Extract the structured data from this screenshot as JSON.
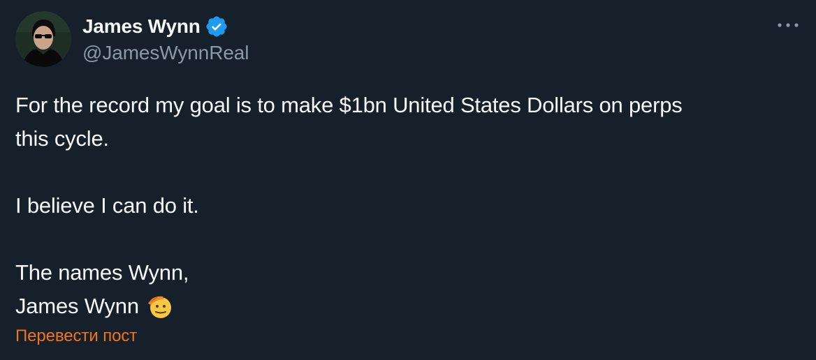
{
  "author": {
    "display_name": "James Wynn",
    "handle": "@JamesWynnReal",
    "verified": true
  },
  "tweet": {
    "line1": "For the record my goal is to make $1bn United States Dollars on perps",
    "line2": "this cycle.",
    "line3": "I believe I can do it.",
    "line4": "The names Wynn,",
    "line5": "James Wynn"
  },
  "actions": {
    "translate_label": "Перевести пост"
  },
  "icons": {
    "verified": "verified-badge-icon",
    "more": "more-options-icon",
    "emoji": "saluting-face-emoji"
  },
  "colors": {
    "background": "#15202b",
    "text": "#f7f9f9",
    "secondary": "#8b98a5",
    "verified": "#1d9bf0",
    "translate": "#f0751a"
  }
}
